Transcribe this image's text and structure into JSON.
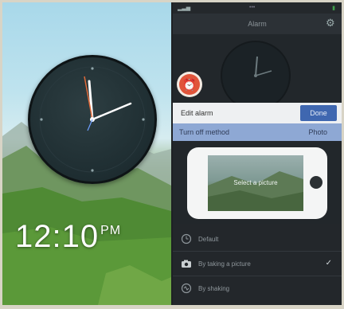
{
  "left_screen": {
    "time": "12:10",
    "ampm": "PM"
  },
  "right_screen": {
    "topbar": {
      "title": "Alarm"
    },
    "edit_bar": {
      "label": "Edit alarm",
      "done_label": "Done"
    },
    "turn_off_method": {
      "label": "Turn off method",
      "value": "Photo"
    },
    "preview": {
      "caption": "Select a picture"
    },
    "options": [
      {
        "label": "Default",
        "icon": "clock-icon",
        "checked": false
      },
      {
        "label": "By taking a picture",
        "icon": "camera-icon",
        "checked": true
      },
      {
        "label": "By shaking",
        "icon": "shake-icon",
        "checked": false
      }
    ]
  },
  "colors": {
    "accent_blue": "#3f67b0",
    "highlight_row": "#8ea8d4",
    "badge_red": "#e0543a"
  }
}
